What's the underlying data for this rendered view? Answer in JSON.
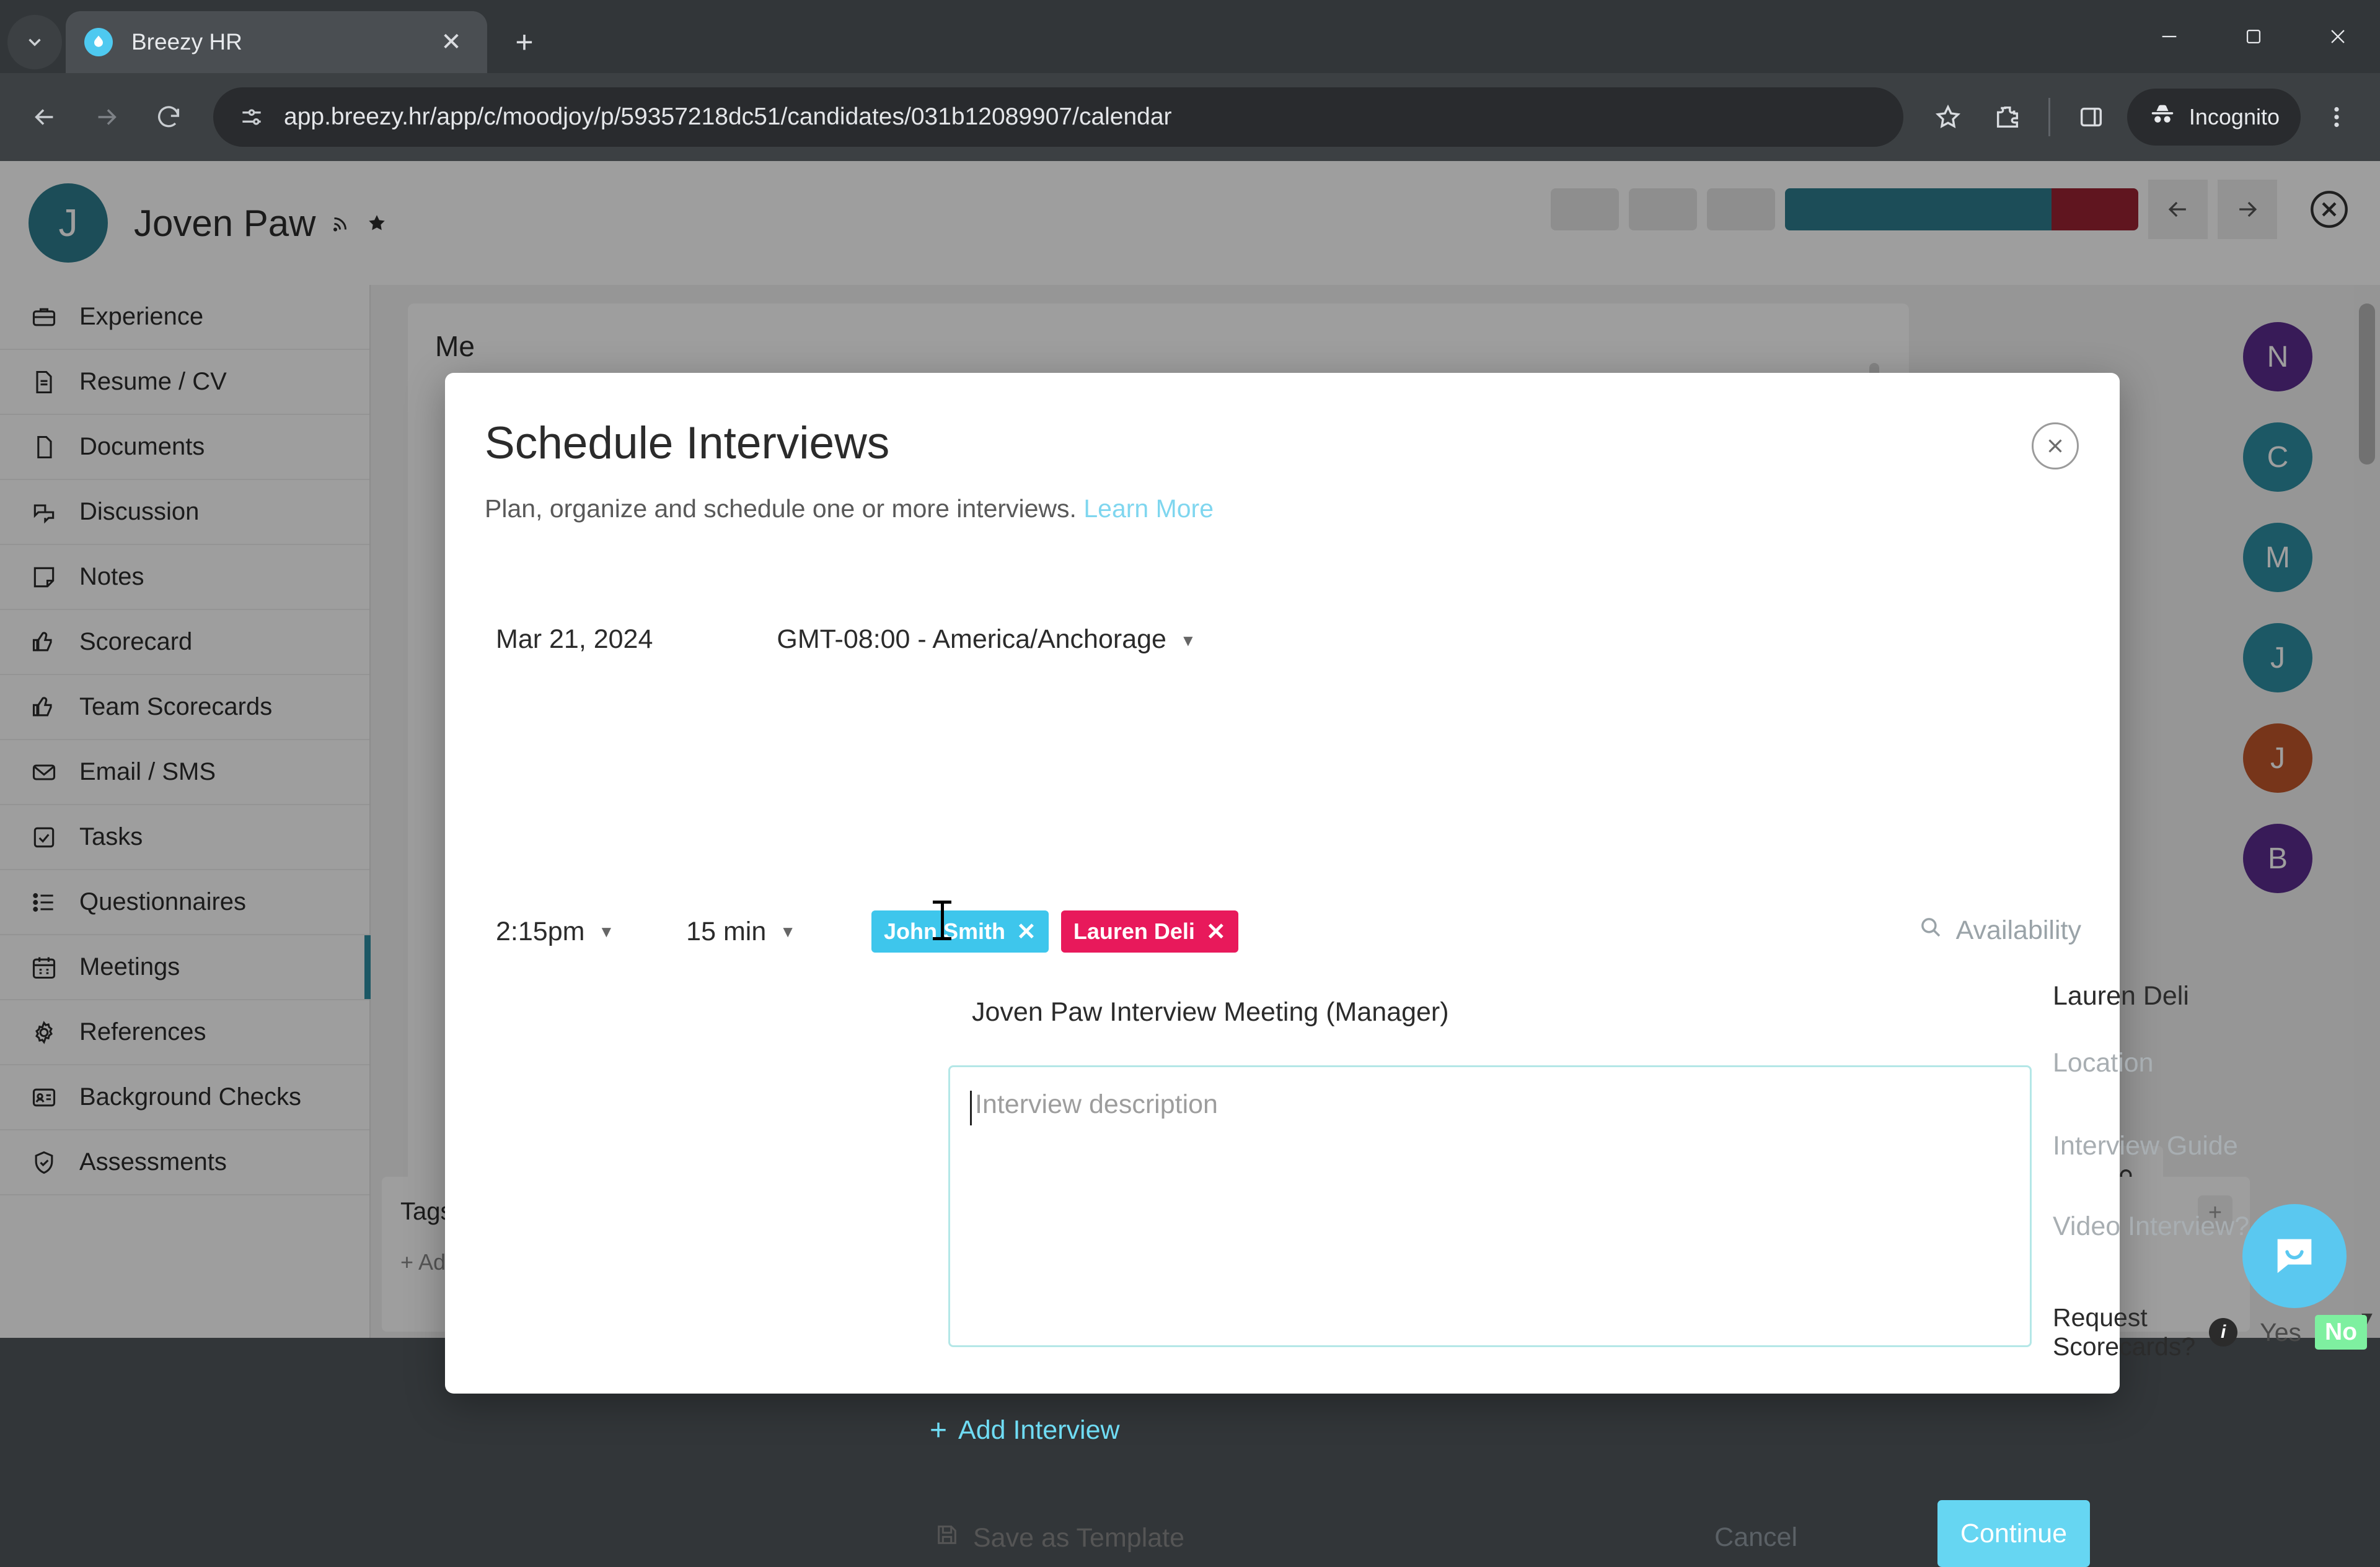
{
  "browser": {
    "tab": {
      "title": "Breezy HR",
      "favicon": "breezy-logo-icon",
      "close_label": "✕"
    },
    "new_tab_label": "+",
    "tab_search_icon": "chevron-down-icon",
    "window": {
      "minimize": "minimize-icon",
      "maximize": "maximize-icon",
      "close": "close-icon"
    },
    "nav": {
      "back": "back-arrow-icon",
      "forward": "forward-arrow-icon",
      "reload": "reload-icon"
    },
    "omnibox": {
      "site_info_icon": "site-settings-icon",
      "url": "app.breezy.hr/app/c/moodjoy/p/59357218dc51/candidates/031b12089907/calendar"
    },
    "actions": {
      "bookmark": "star-icon",
      "extensions": "extensions-icon",
      "side_panel": "side-panel-icon",
      "menu": "kebab-menu-icon"
    },
    "profile": {
      "label": "Incognito",
      "icon": "incognito-icon"
    }
  },
  "app": {
    "candidate": {
      "initial": "J",
      "name": "Joven Paw",
      "rss_icon": "rss-icon",
      "star_icon": "star-filled-icon"
    },
    "header_nav": {
      "prev": "arrow-left-icon",
      "next": "arrow-right-icon",
      "close": "close-circle-icon"
    },
    "sidebar": {
      "items": [
        {
          "label": "Experience",
          "icon": "briefcase-icon",
          "active": false
        },
        {
          "label": "Resume / CV",
          "icon": "document-lines-icon",
          "active": false
        },
        {
          "label": "Documents",
          "icon": "file-icon",
          "active": false
        },
        {
          "label": "Discussion",
          "icon": "chat-bubbles-icon",
          "active": false
        },
        {
          "label": "Notes",
          "icon": "note-icon",
          "active": false
        },
        {
          "label": "Scorecard",
          "icon": "thumbs-up-icon",
          "active": false
        },
        {
          "label": "Team Scorecards",
          "icon": "thumbs-up-icon",
          "active": false
        },
        {
          "label": "Email / SMS",
          "icon": "envelope-icon",
          "active": false
        },
        {
          "label": "Tasks",
          "icon": "checkbox-icon",
          "active": false
        },
        {
          "label": "Questionnaires",
          "icon": "list-icon",
          "active": false
        },
        {
          "label": "Meetings",
          "icon": "calendar-icon",
          "active": true
        },
        {
          "label": "References",
          "icon": "gear-icon",
          "active": false
        },
        {
          "label": "Background Checks",
          "icon": "id-card-icon",
          "active": false
        },
        {
          "label": "Assessments",
          "icon": "shield-check-icon",
          "active": false
        }
      ]
    },
    "content": {
      "title": "Me"
    },
    "rail_avatars": [
      {
        "initial": "N",
        "color": "#5b2d8e"
      },
      {
        "initial": "C",
        "color": "#2e8fa3"
      },
      {
        "initial": "M",
        "color": "#2e8fa3"
      },
      {
        "initial": "J",
        "color": "#2e8fa3"
      },
      {
        "initial": "J",
        "color": "#c0562a"
      },
      {
        "initial": "B",
        "color": "#5b2d8e"
      }
    ],
    "tags": {
      "title": "Tags",
      "add_label": "+ Add tags",
      "plus_label": "+"
    },
    "lock_icon": "lock-icon",
    "scroll_arrow": "▼",
    "intercom_icon": "intercom-chat-icon"
  },
  "modal": {
    "title": "Schedule Interviews",
    "subtitle": "Plan, organize and schedule one or more interviews.",
    "learn_more": "Learn More",
    "close_icon": "close-icon",
    "date": "Mar 21, 2024",
    "timezone": "GMT-08:00 - America/Anchorage",
    "time": "2:15pm",
    "duration": "15 min",
    "attendees": [
      {
        "name": "John Smith",
        "color": "#3ec6ec",
        "remove_label": "✕"
      },
      {
        "name": "Lauren Deli",
        "color": "#e8195b",
        "remove_label": "✕"
      }
    ],
    "availability_label": "Availability",
    "availability_icon": "search-icon",
    "meeting_title": "Joven Paw Interview Meeting (Manager)",
    "description_placeholder": "Interview description",
    "description_value": "",
    "interviewer": "Lauren Deli",
    "interviewer_info_icon": "info-icon",
    "location_placeholder": "Location",
    "location_value": "",
    "interview_guide_placeholder": "Interview Guide",
    "video_interview_placeholder": "Video Interview?",
    "request_scorecards_label": "Request Scorecards?",
    "request_scorecards_info_icon": "info-icon",
    "scorecards_yes": "Yes",
    "scorecards_no": "No",
    "scorecards_selected": "No",
    "add_interview_label": "Add Interview",
    "add_interview_plus": "+",
    "save_template_label": "Save as Template",
    "save_template_icon": "save-icon",
    "cancel_label": "Cancel",
    "continue_label": "Continue",
    "accent_color": "#66d6f2",
    "focus_border_color": "#b4e7e7"
  }
}
